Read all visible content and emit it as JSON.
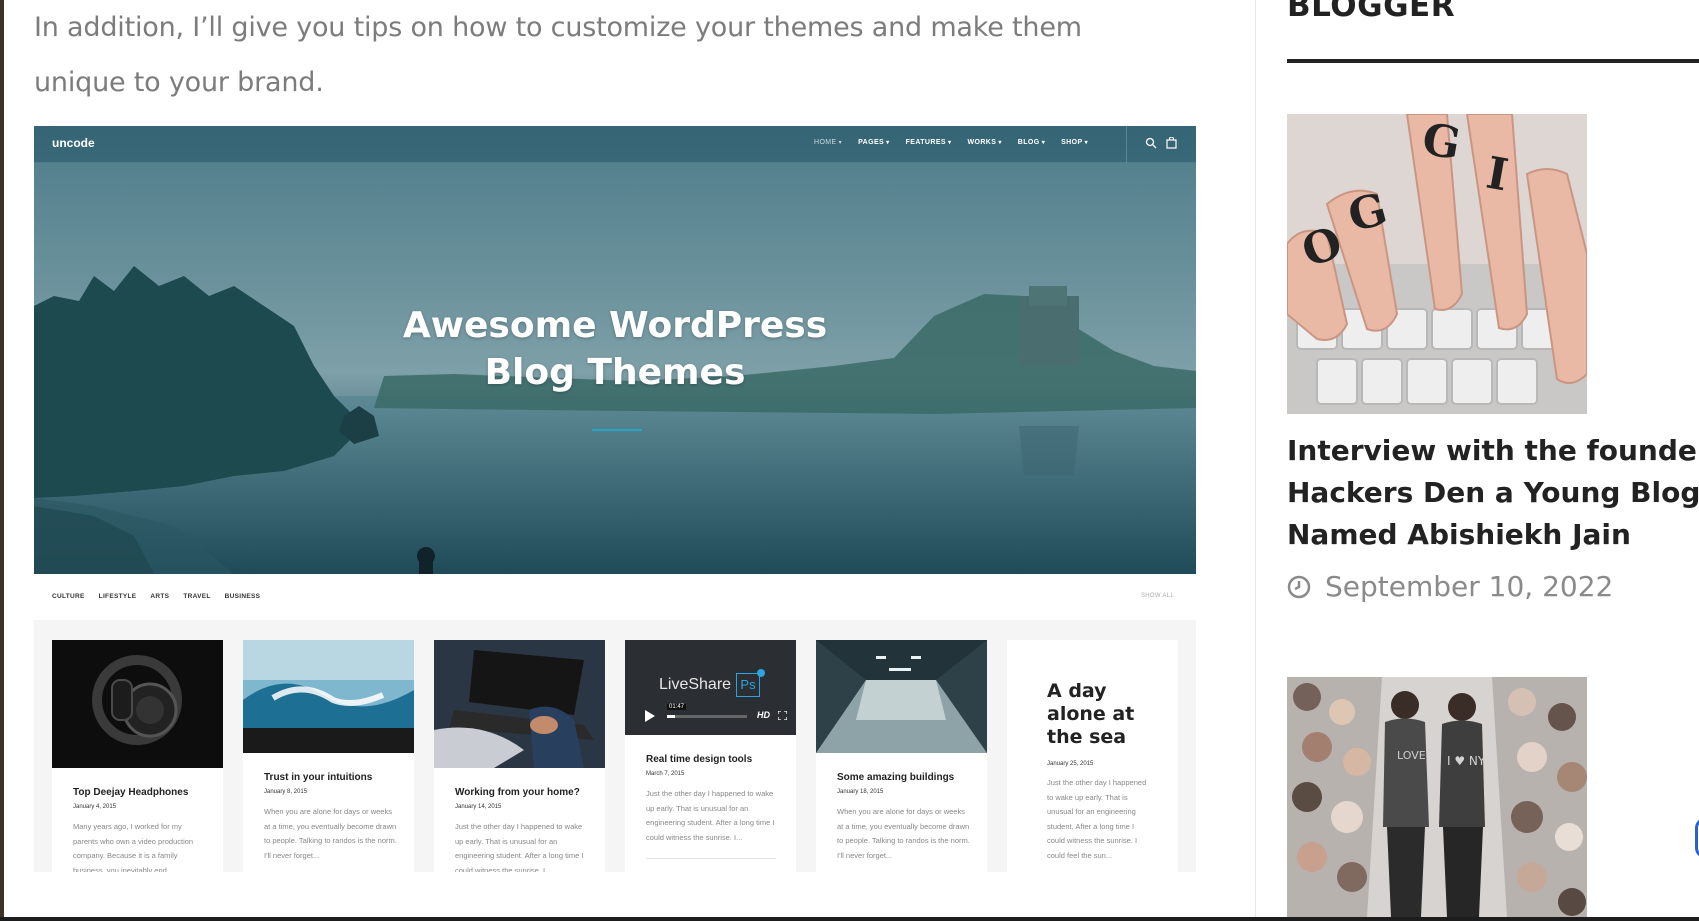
{
  "article": {
    "intro_line1": "In addition, I’ll give you tips on how to customize your themes and make them",
    "intro_line2": "unique to your brand."
  },
  "theme_screenshot": {
    "logo": "uncode",
    "nav": [
      "HOME",
      "PAGES",
      "FEATURES",
      "WORKS",
      "BLOG",
      "SHOP"
    ],
    "hero_title_line1": "Awesome WordPress",
    "hero_title_line2": "Blog Themes",
    "categories": [
      "CULTURE",
      "LIFESTYLE",
      "ARTS",
      "TRAVEL",
      "BUSINESS"
    ],
    "show_all": "SHOW ALL",
    "video_brand": "LiveShare",
    "video_badge": "Ps",
    "video_time": "01:47",
    "video_hd": "HD",
    "cards": [
      {
        "title": "Top Deejay Headphones",
        "date": "January 4, 2015",
        "excerpt": "Many years ago, I worked for my parents who own a video production company. Because it is a family business, you inevitably end"
      },
      {
        "title": "Trust in your intuitions",
        "date": "January 8, 2015",
        "excerpt": "When you are alone for days or weeks at a time, you eventually become drawn to people. Talking to randos is the norm. I'll never forget..."
      },
      {
        "title": "Working from your home?",
        "date": "January 14, 2015",
        "excerpt": "Just the other day I happened to wake up early. That is unusual for an engineering student. After a long time I could witness the sunrise. I..."
      },
      {
        "title": "Real time design tools",
        "date": "March 7, 2015",
        "excerpt": "Just the other day I happened to wake up early. That is unusual for an engineering student. After a long time I could witness the sunrise. I..."
      },
      {
        "title": "Some amazing buildings",
        "date": "January 18, 2015",
        "excerpt": "When you are alone for days or weeks at a time, you eventually become drawn to people. Talking to randos is the norm. I'll never forget..."
      },
      {
        "title": "A day alone at the sea",
        "date": "January 25, 2015",
        "excerpt": "Just the other day I happened to wake up early. That is unusual for an engineering student. After a long time I could witness the sunrise. I could feel the sun..."
      }
    ]
  },
  "sidebar": {
    "heading": "BLOGGER",
    "post": {
      "title_line1": "Interview with the founder of",
      "title_line2": "Hackers Den a Young Blogger",
      "title_line3": "Named Abishiekh Jain",
      "date": "September 10, 2022"
    },
    "thumb1_letters": [
      "O",
      "G",
      "G",
      "I"
    ],
    "thumb2_jacket_text": [
      "I ♥ NY",
      "LOVE"
    ]
  },
  "colors": {
    "accent": "#2aa3c4",
    "text_dark": "#222222",
    "text_muted": "#7c7c7c"
  }
}
